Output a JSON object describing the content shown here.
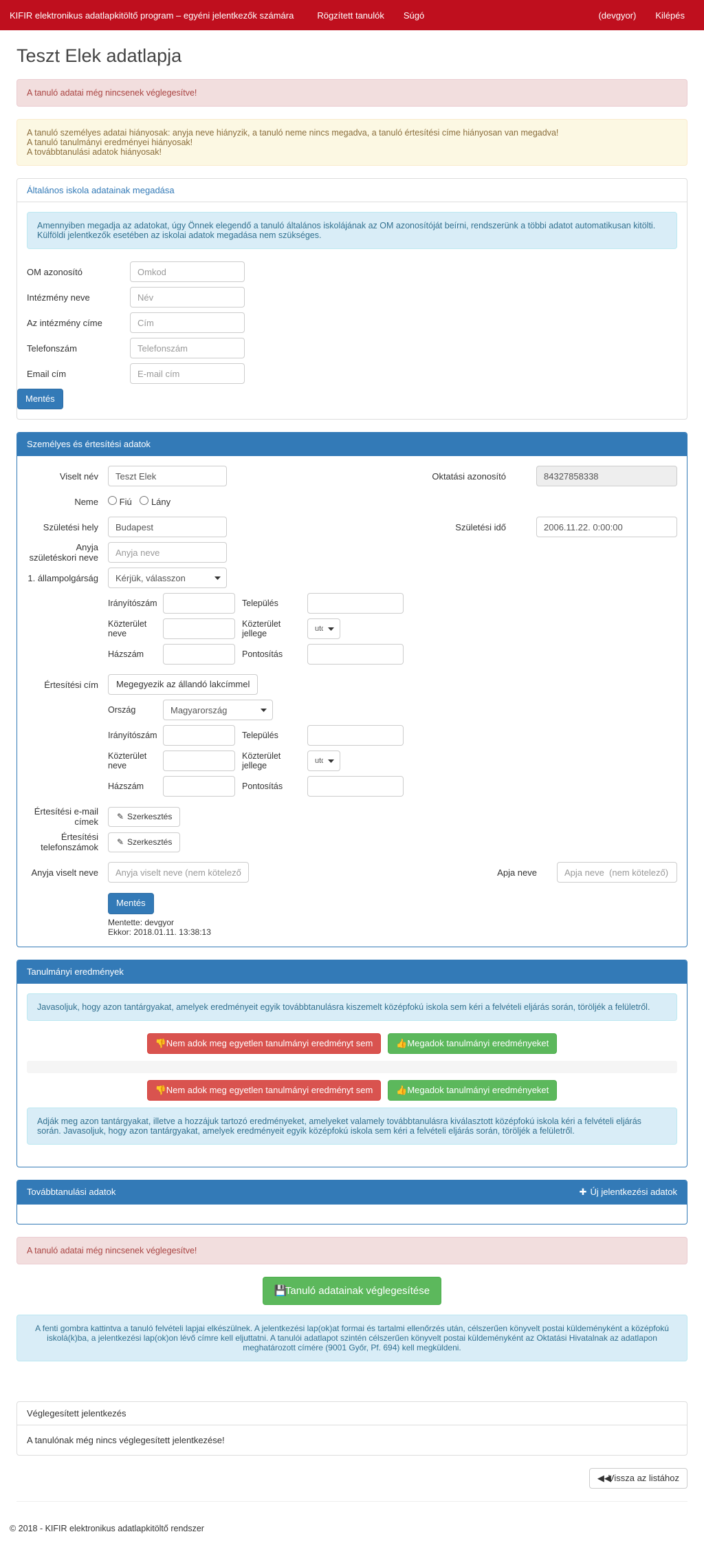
{
  "nav": {
    "brand": "KIFIR elektronikus adatlapkitöltő program – egyéni jelentkezők számára",
    "link1": "Rögzített tanulók",
    "link2": "Súgó",
    "user": "(devgyor)",
    "logout": "Kilépés"
  },
  "title": "Teszt Elek adatlapja",
  "alert_danger": "A tanuló adatai még nincsenek véglegesítve!",
  "warn_line1": "A tanuló személyes adatai hiányosak: anyja neve hiányzik, a tanuló neme nincs megadva, a tanuló értesítési címe hiányosan van megadva!",
  "warn_line2": "A tanuló tanulmányi eredményei hiányosak!",
  "warn_line3": "A továbbtanulási adatok hiányosak!",
  "school": {
    "heading": "Általános iskola adatainak megadása",
    "info": "Amennyiben megadja az adatokat, úgy Önnek elegendő a tanuló általános iskolájának az OM azonosítóját beírni, rendszerünk a többi adatot automatikusan kitölti. Külföldi jelentkezők esetében az iskolai adatok megadása nem szükséges.",
    "om_label": "OM azonosító",
    "om_ph": "Omkod",
    "name_label": "Intézmény neve",
    "name_ph": "Név",
    "addr_label": "Az intézmény címe",
    "addr_ph": "Cím",
    "phone_label": "Telefonszám",
    "phone_ph": "Telefonszám",
    "email_label": "Email cím",
    "email_ph": "E-mail cím"
  },
  "save": "Mentés",
  "personal": {
    "heading": "Személyes és értesítési adatok",
    "name_label": "Viselt név",
    "name_val": "Teszt Elek",
    "oid_label": "Oktatási azonosító",
    "oid_val": "84327858338",
    "gender_label": "Neme",
    "male": "Fiú",
    "female": "Lány",
    "birthplace_label": "Születési hely",
    "birthplace_val": "Budapest",
    "birthdate_label": "Születési idő",
    "birthdate_val": "2006.11.22. 0:00:00",
    "mother_label": "Anyja születéskori neve",
    "mother_ph": "Anyja neve",
    "citizen1_label": "1. állampolgárság",
    "citizen1_val": "Kérjük, válasszon",
    "addr": {
      "zip": "Irányítószám",
      "city": "Település",
      "street": "Közterület neve",
      "type": "Közterület jellege",
      "type_val": "utca",
      "num": "Házszám",
      "detail": "Pontosítás"
    },
    "notif_label": "Értesítési cím",
    "same_btn": "Megegyezik az állandó lakcímmel",
    "country": "Ország",
    "country_val": "Magyarország",
    "emails_label": "Értesítési e-mail címek",
    "phones_label": "Értesítési telefonszámok",
    "edit": "Szerkesztés",
    "mother_fullname_label": "Anyja viselt neve",
    "mother_fullname_ph": "Anyja viselt neve (nem kötelező)",
    "father_label": "Apja neve",
    "father_ph": "Apja neve  (nem kötelező)",
    "saved_by": "Mentette: devgyor",
    "saved_at": "Ekkor: 2018.01.11. 13:38:13"
  },
  "results": {
    "heading": "Tanulmányi eredmények",
    "info": "Javasoljuk, hogy azon tantárgyakat, amelyek eredményeit egyik továbbtanulásra kiszemelt középfokú iskola sem kéri a felvételi eljárás során, töröljék a felületről.",
    "no_btn": "Nem adok meg egyetlen tanulmányi eredményt sem",
    "yes_btn": "Megadok tanulmányi eredményeket",
    "info2a": "Adják meg azon tantárgyakat, illetve a hozzájuk tartozó eredményeket, amelyeket valamely továbbtanulásra kiválasztott középfokú iskola kéri a felvételi eljárás során.",
    "info2b": "Javasoljuk, hogy azon tantárgyakat, amelyek eredményeit egyik középfokú iskola sem kéri a felvételi eljárás során, töröljék a felületről."
  },
  "further": {
    "heading": "Továbbtanulási adatok",
    "add": "Új jelentkezési adatok"
  },
  "finalize_btn": "Tanuló adatainak véglegesítése",
  "finalize_info": "A fenti gombra kattintva a tanuló felvételi lapjai elkészülnek. A jelentkezési lap(ok)at formai és tartalmi ellenőrzés után, célszerűen könyvelt postai küldeményként a középfokú iskolá(k)ba, a jelentkezési lap(ok)on lévő címre kell eljuttatni. A tanulói adatlapot szintén célszerűen könyvelt postai küldeményként az Oktatási Hivatalnak az adatlapon meghatározott címére (9001 Győr, Pf. 694) kell megküldeni.",
  "final_heading": "Véglegesített jelentkezés",
  "final_text": "A tanulónak még nincs véglegesített jelentkezése!",
  "back_btn": "Vissza az listához",
  "footer": "© 2018 - KIFIR elektronikus adatlapkitöltő rendszer"
}
